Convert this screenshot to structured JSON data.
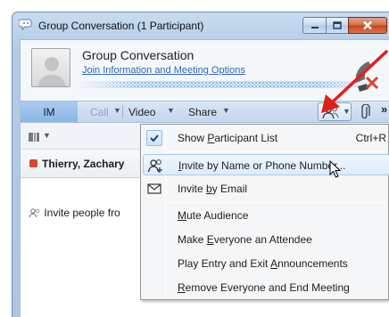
{
  "window": {
    "title": "Group Conversation (1 Participant)"
  },
  "header": {
    "conversation_title": "Group Conversation",
    "info_link": "Join Information and Meeting Options"
  },
  "toolbar": {
    "im_label": "IM",
    "call_label": "Call",
    "video_label": "Video",
    "share_label": "Share"
  },
  "participants": {
    "items": [
      {
        "name": "Thierry, Zachary",
        "status_color": "#d9452b"
      }
    ],
    "invite_text": "Invite people fro"
  },
  "menu": {
    "items": [
      {
        "pre": "Show ",
        "key": "P",
        "post": "articipant List",
        "shortcut": "Ctrl+R",
        "checked": true,
        "icon": "checkmark-icon"
      },
      {
        "pre": "",
        "key": "I",
        "post": "nvite by Name or Phone Number...",
        "shortcut": "",
        "icon": "invite-people-icon"
      },
      {
        "pre": "Invite ",
        "key": "b",
        "post": "y Email",
        "shortcut": "",
        "icon": "envelope-icon"
      },
      {
        "pre": "",
        "key": "M",
        "post": "ute Audience",
        "shortcut": ""
      },
      {
        "pre": "Make ",
        "key": "E",
        "post": "veryone an Attendee",
        "shortcut": ""
      },
      {
        "pre": "Play Entry and Exit ",
        "key": "A",
        "post": "nnouncements",
        "shortcut": ""
      },
      {
        "pre": "",
        "key": "R",
        "post": "emove Everyone and End Meeting",
        "shortcut": ""
      }
    ]
  },
  "colors": {
    "accent": "#3064b8",
    "annotation_arrow": "#e0201b",
    "hover_border": "#a7cdf0"
  }
}
